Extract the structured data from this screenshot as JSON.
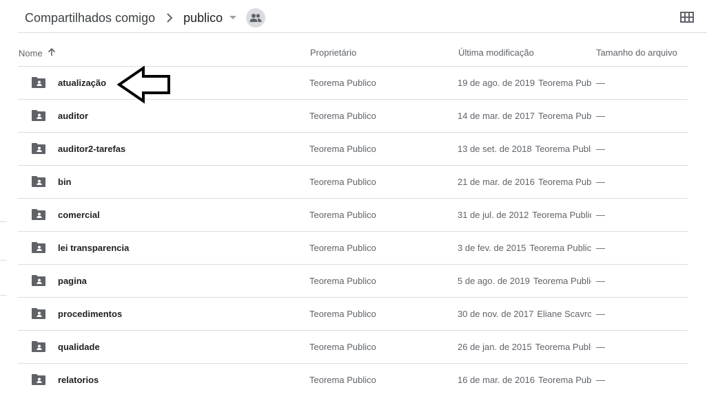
{
  "breadcrumb": {
    "parent": "Compartilhados comigo",
    "current": "publico"
  },
  "icons": {
    "separator": "chevron-right-icon",
    "dropdown": "arrow-drop-down-icon",
    "shared": "people-icon",
    "view_toggle": "grid-view-icon",
    "folder": "shared-folder-icon",
    "sort": "arrow-up-icon",
    "annotation": "arrow-left-outline-icon"
  },
  "table": {
    "columns": {
      "name": "Nome",
      "owner": "Proprietário",
      "modified": "Última modificação",
      "size": "Tamanho do arquivo"
    },
    "rows": [
      {
        "name": "atualização",
        "owner": "Teorema Publico",
        "modified_date": "19 de ago. de 2019",
        "modified_by": "Teorema Publico",
        "size": "—"
      },
      {
        "name": "auditor",
        "owner": "Teorema Publico",
        "modified_date": "14 de mar. de 2017",
        "modified_by": "Teorema Publico",
        "size": "—"
      },
      {
        "name": "auditor2-tarefas",
        "owner": "Teorema Publico",
        "modified_date": "13 de set. de 2018",
        "modified_by": "Teorema Publico",
        "size": "—"
      },
      {
        "name": "bin",
        "owner": "Teorema Publico",
        "modified_date": "21 de mar. de 2016",
        "modified_by": "Teorema Publico",
        "size": "—"
      },
      {
        "name": "comercial",
        "owner": "Teorema Publico",
        "modified_date": "31 de jul. de 2012",
        "modified_by": "Teorema Publico",
        "size": "—"
      },
      {
        "name": "lei transparencia",
        "owner": "Teorema Publico",
        "modified_date": "3 de fev. de 2015",
        "modified_by": "Teorema Publico",
        "size": "—"
      },
      {
        "name": "pagina",
        "owner": "Teorema Publico",
        "modified_date": "5 de ago. de 2019",
        "modified_by": "Teorema Publico",
        "size": "—"
      },
      {
        "name": "procedimentos",
        "owner": "Teorema Publico",
        "modified_date": "30 de nov. de 2017",
        "modified_by": "Eliane Scavroni",
        "size": "—"
      },
      {
        "name": "qualidade",
        "owner": "Teorema Publico",
        "modified_date": "26 de jan. de 2015",
        "modified_by": "Teorema Publico",
        "size": "—"
      },
      {
        "name": "relatorios",
        "owner": "Teorema Publico",
        "modified_date": "16 de mar. de 2016",
        "modified_by": "Teorema Publico",
        "size": "—"
      }
    ]
  },
  "colors": {
    "text_primary": "#202124",
    "text_secondary": "#5f6368",
    "divider": "#dadce0",
    "folder_icon": "#5f6368"
  }
}
